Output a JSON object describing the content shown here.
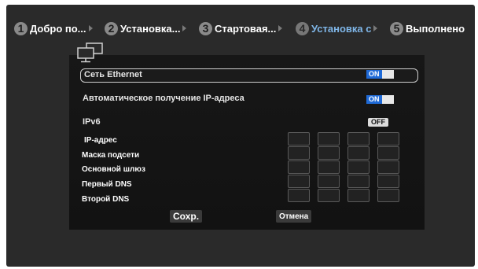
{
  "wizard": {
    "steps": [
      {
        "num": "1",
        "label": "Добро по..."
      },
      {
        "num": "2",
        "label": "Установка..."
      },
      {
        "num": "3",
        "label": "Стартовая..."
      },
      {
        "num": "4",
        "label": "Установка с"
      },
      {
        "num": "5",
        "label": "Выполнено"
      }
    ],
    "active_step": 4
  },
  "network": {
    "ethernet": {
      "label": "Сеть Ethernet",
      "state": "ON"
    },
    "dhcp": {
      "label": "Автоматическое получение IP-адреса",
      "state": "ON"
    },
    "ipv6": {
      "label": "IPv6",
      "state": "OFF"
    },
    "fields": [
      {
        "label": "IP-адрес"
      },
      {
        "label": "Маска подсети"
      },
      {
        "label": "Основной шлюз"
      },
      {
        "label": "Первый DNS"
      },
      {
        "label": "Второй DNS"
      }
    ]
  },
  "buttons": {
    "save": "Сохр.",
    "cancel": "Отмена"
  },
  "colors": {
    "accent": "#1f6ad7",
    "active_step_text": "#7fb6e8",
    "panel_bg": "#171717"
  }
}
